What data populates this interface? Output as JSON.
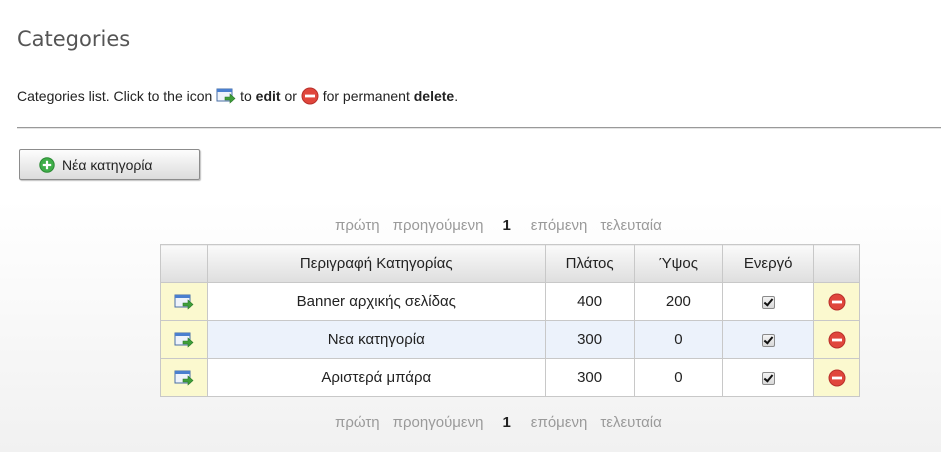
{
  "page": {
    "title": "Categories",
    "intro_prefix": "Categories list. Click to the icon",
    "intro_to": "to",
    "intro_edit": "edit",
    "intro_or": "or",
    "intro_for": "for permanent",
    "intro_delete": "delete",
    "intro_period": "."
  },
  "add_button": {
    "label": "Νέα κατηγορία",
    "icon": "green-plus-icon"
  },
  "pager": {
    "first": "πρώτη",
    "previous": "προηγούμενη",
    "current": "1",
    "next": "επόμενη",
    "last": "τελευταία"
  },
  "table": {
    "columns": [
      "",
      "Περιγραφή Κατηγορίας",
      "Πλάτος",
      "Ύψος",
      "Ενεργό",
      ""
    ],
    "rows": [
      {
        "description": "Banner αρχικής σελίδας",
        "width": "400",
        "height": "200",
        "active": true
      },
      {
        "description": "Νεα κατηγορία",
        "width": "300",
        "height": "0",
        "active": true
      },
      {
        "description": "Αριστερά μπάρα",
        "width": "300",
        "height": "0",
        "active": true
      }
    ]
  },
  "colors": {
    "icon_cell_bg": "#fbf9cf",
    "alt_row_bg": "#ecf2fb",
    "delete_red": "#e0463c",
    "add_green": "#3fae49",
    "pager_gray": "#9a9a9a"
  }
}
